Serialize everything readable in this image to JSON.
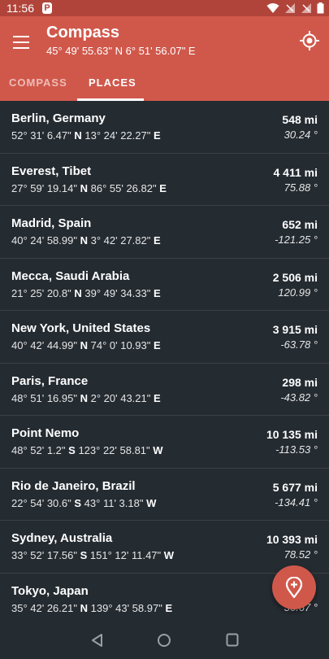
{
  "status": {
    "time": "11:56",
    "notification_icon": "P"
  },
  "appbar": {
    "title": "Compass",
    "coords": "45° 49' 55.63\" N 6° 51' 56.07\" E",
    "menu_icon": "menu-icon",
    "locate_icon": "gps-icon",
    "color": "#d0584b"
  },
  "tabs": [
    {
      "label": "COMPASS",
      "active": false
    },
    {
      "label": "PLACES",
      "active": true
    }
  ],
  "places": [
    {
      "name": "Berlin, Germany",
      "lat": "52° 31' 6.47\"",
      "lat_dir": "N",
      "lon": "13° 24' 22.27\"",
      "lon_dir": "E",
      "distance": "548 mi",
      "bearing": "30.24 °"
    },
    {
      "name": "Everest, Tibet",
      "lat": "27° 59' 19.14\"",
      "lat_dir": "N",
      "lon": "86° 55' 26.82\"",
      "lon_dir": "E",
      "distance": "4 411 mi",
      "bearing": "75.88 °"
    },
    {
      "name": "Madrid, Spain",
      "lat": "40° 24' 58.99\"",
      "lat_dir": "N",
      "lon": "3° 42' 27.82\"",
      "lon_dir": "E",
      "distance": "652 mi",
      "bearing": "-121.25 °"
    },
    {
      "name": "Mecca, Saudi Arabia",
      "lat": "21° 25' 20.8\"",
      "lat_dir": "N",
      "lon": "39° 49' 34.33\"",
      "lon_dir": "E",
      "distance": "2 506 mi",
      "bearing": "120.99 °"
    },
    {
      "name": "New York, United States",
      "lat": "40° 42' 44.99\"",
      "lat_dir": "N",
      "lon": "74° 0' 10.93\"",
      "lon_dir": "E",
      "distance": "3 915 mi",
      "bearing": "-63.78 °"
    },
    {
      "name": "Paris, France",
      "lat": "48° 51' 16.95\"",
      "lat_dir": "N",
      "lon": "2° 20' 43.21\"",
      "lon_dir": "E",
      "distance": "298 mi",
      "bearing": "-43.82 °"
    },
    {
      "name": "Point Nemo",
      "lat": "48° 52' 1.2\"",
      "lat_dir": "S",
      "lon": "123° 22' 58.81\"",
      "lon_dir": "W",
      "distance": "10 135 mi",
      "bearing": "-113.53 °"
    },
    {
      "name": "Rio de Janeiro, Brazil",
      "lat": "22° 54' 30.6\"",
      "lat_dir": "S",
      "lon": "43° 11' 3.18\"",
      "lon_dir": "W",
      "distance": "5 677 mi",
      "bearing": "-134.41 °"
    },
    {
      "name": "Sydney, Australia",
      "lat": "33° 52' 17.56\"",
      "lat_dir": "S",
      "lon": "151° 12' 11.47\"",
      "lon_dir": "W",
      "distance": "10 393 mi",
      "bearing": "78.52 °"
    },
    {
      "name": "Tokyo, Japan",
      "lat": "35° 42' 26.21\"",
      "lat_dir": "N",
      "lon": "139° 43' 58.97\"",
      "lon_dir": "E",
      "distance": "",
      "bearing": "36.67 °"
    }
  ],
  "fab": {
    "icon": "add-location-icon"
  },
  "navbar": {
    "back_icon": "back-icon",
    "home_icon": "home-icon",
    "recents_icon": "recents-icon"
  }
}
